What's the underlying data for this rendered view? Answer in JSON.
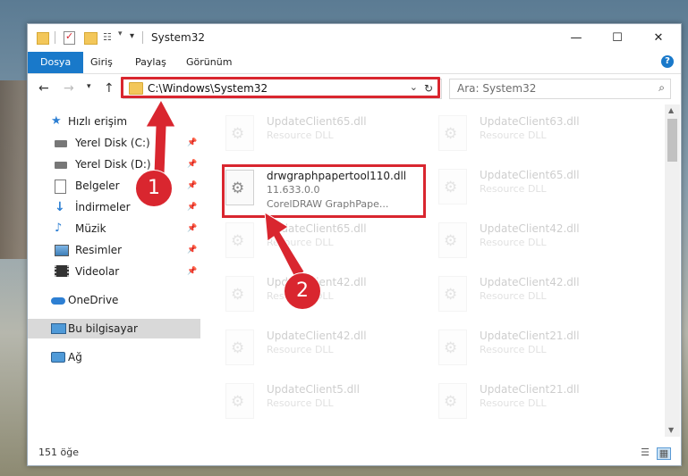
{
  "window": {
    "title": "System32",
    "minimize_glyph": "—",
    "maximize_glyph": "☐",
    "close_glyph": "✕"
  },
  "ribbon": {
    "tabs": [
      "Dosya",
      "Giriş",
      "Paylaş",
      "Görünüm"
    ],
    "help_glyph": "?"
  },
  "navigation": {
    "address": "C:\\Windows\\System32",
    "search_placeholder": "Ara: System32"
  },
  "sidebar": {
    "quick_access": "Hızlı erişim",
    "items": [
      {
        "label": "Yerel Disk (C:)",
        "icon": "drive-icon"
      },
      {
        "label": "Yerel Disk (D:)",
        "icon": "drive-icon"
      },
      {
        "label": "Belgeler",
        "icon": "documents-icon"
      },
      {
        "label": "İndirmeler",
        "icon": "download-icon"
      },
      {
        "label": "Müzik",
        "icon": "music-icon"
      },
      {
        "label": "Resimler",
        "icon": "pictures-icon"
      },
      {
        "label": "Videolar",
        "icon": "videos-icon"
      }
    ],
    "onedrive": "OneDrive",
    "this_pc": "Bu bilgisayar",
    "network": "Ağ"
  },
  "files": {
    "left": [
      {
        "name": "UpdateClient65.dll",
        "desc": "Resource DLL"
      },
      {
        "name": "drwgraphpapertool110.dll",
        "version": "11.633.0.0",
        "desc": "CorelDRAW GraphPape..."
      },
      {
        "name": "UpdateClient65.dll",
        "desc": "Resource DLL"
      },
      {
        "name": "UpdateClient42.dll",
        "desc": "Resource DLL"
      },
      {
        "name": "UpdateClient42.dll",
        "desc": "Resource DLL"
      },
      {
        "name": "UpdateClient5.dll",
        "desc": "Resource DLL"
      }
    ],
    "right": [
      {
        "name": "UpdateClient63.dll",
        "desc": "Resource DLL"
      },
      {
        "name": "UpdateClient65.dll",
        "desc": "Resource DLL"
      },
      {
        "name": "UpdateClient42.dll",
        "desc": "Resource DLL"
      },
      {
        "name": "UpdateClient42.dll",
        "desc": "Resource DLL"
      },
      {
        "name": "UpdateClient21.dll",
        "desc": "Resource DLL"
      },
      {
        "name": "UpdateClient21.dll",
        "desc": "Resource DLL"
      }
    ]
  },
  "status": {
    "count": "151 öğe"
  },
  "annotations": {
    "step1": "1",
    "step2": "2",
    "color": "#d9262f"
  }
}
